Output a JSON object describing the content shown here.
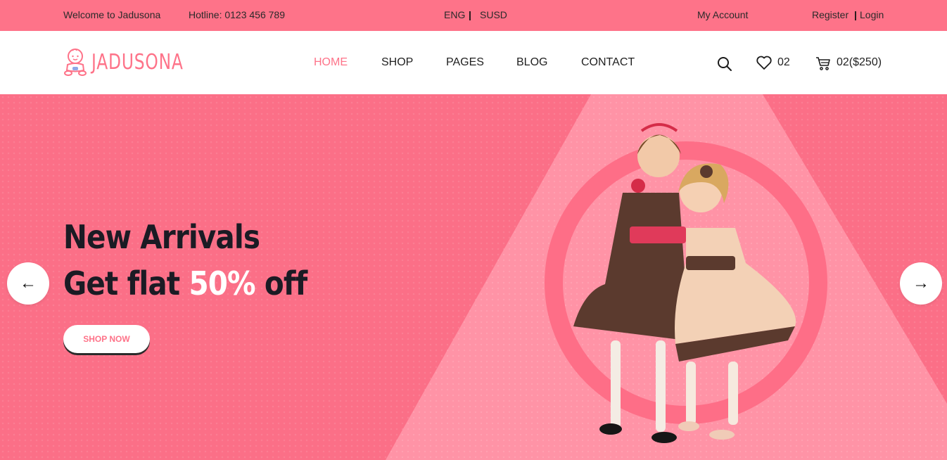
{
  "topbar": {
    "welcome": "Welcome to Jadusona",
    "hotline": "Hotline: 0123 456 789",
    "language": "ENG",
    "separator": "|",
    "currency": "SUSD",
    "my_account": "My Account",
    "register": "Register",
    "login": "Login"
  },
  "header": {
    "logo_text": "JADUSONA",
    "nav": [
      "HOME",
      "SHOP",
      "PAGES",
      "BLOG",
      "CONTACT"
    ],
    "active_nav": "HOME",
    "wishlist_count": "02",
    "cart_summary": "02($250)"
  },
  "hero": {
    "headline_line1": "New Arrivals",
    "headline_line2_prefix": "Get flat ",
    "headline_highlight": "50%",
    "headline_line2_suffix": " off",
    "cta_label": "SHOP NOW",
    "prev_arrow": "←",
    "next_arrow": "→"
  },
  "colors": {
    "brand_pink": "#fe7389",
    "hero_pink": "#fb6f87",
    "light_pink": "#ff95a7",
    "dark_text": "#1b1b24"
  },
  "icons": [
    "baby-logo-icon",
    "search-icon",
    "heart-icon",
    "cart-icon",
    "arrow-left-icon",
    "arrow-right-icon"
  ]
}
